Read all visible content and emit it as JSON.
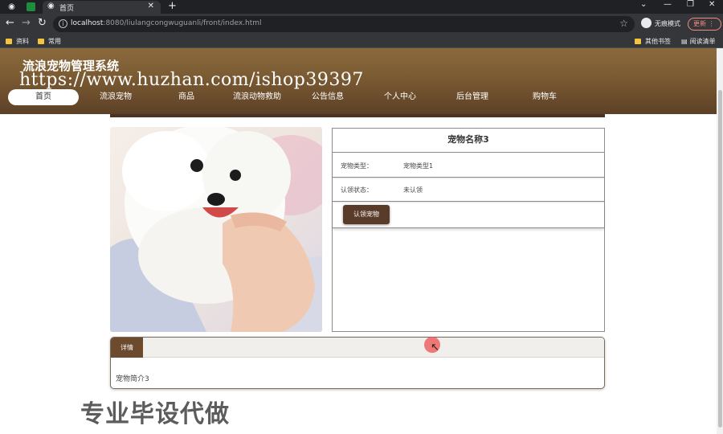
{
  "browser": {
    "tab_title": "首页",
    "url_host": "localhost",
    "url_path": ":8080/liulangcongwuguanli/front/index.html",
    "incognito_label": "无痕模式",
    "update_label": "更新",
    "bookmarks": [
      "资料",
      "常用"
    ],
    "bookmarks_right": [
      "其他书签",
      "阅读清单"
    ]
  },
  "header": {
    "site_title": "流浪宠物管理系统",
    "watermark_url": "https://www.huzhan.com/ishop39397"
  },
  "nav": {
    "items": [
      "首页",
      "流浪宠物",
      "商品",
      "流浪动物救助",
      "公告信息",
      "个人中心",
      "后台管理",
      "购物车"
    ],
    "active": "首页"
  },
  "pet": {
    "name": "宠物名称3",
    "type_label": "宠物类型：",
    "type_value": "宠物类型1",
    "status_label": "认领状态：",
    "status_value": "未认领",
    "adopt_button": "认领宠物",
    "photo_icon": "white-puppy-photo"
  },
  "detail": {
    "tab_label": "详情",
    "text": "宠物简介3"
  },
  "watermark_bottom": "专业毕设代做",
  "colors": {
    "header_brown": "#7a5a32",
    "button_brown": "#5a3a28",
    "tab_brown": "#6b4a2e"
  }
}
